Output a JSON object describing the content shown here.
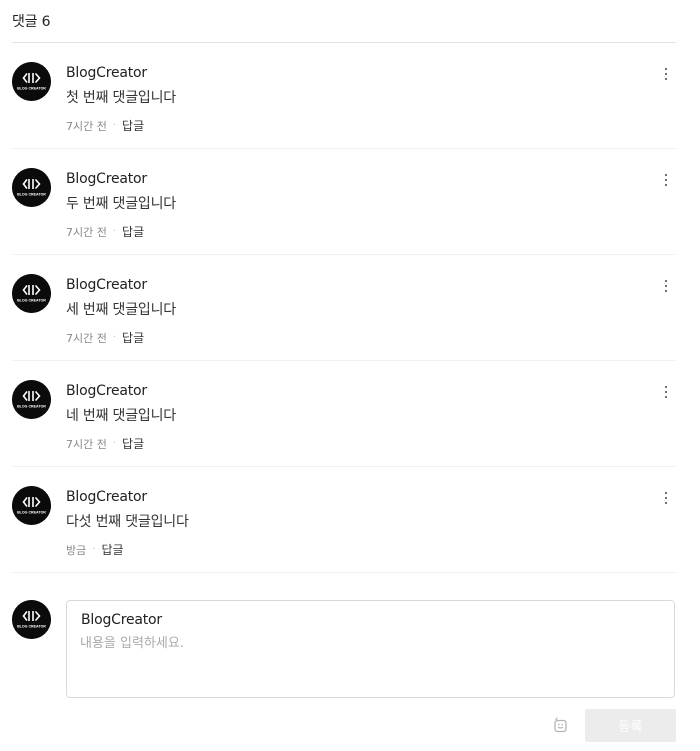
{
  "header": {
    "label": "댓글 6"
  },
  "comments": [
    {
      "author": "BlogCreator",
      "text": "첫 번째 댓글입니다",
      "time": "7시간 전",
      "reply": "답글"
    },
    {
      "author": "BlogCreator",
      "text": "두 번째 댓글입니다",
      "time": "7시간 전",
      "reply": "답글"
    },
    {
      "author": "BlogCreator",
      "text": "세 번째 댓글입니다",
      "time": "7시간 전",
      "reply": "답글"
    },
    {
      "author": "BlogCreator",
      "text": "네 번째 댓글입니다",
      "time": "7시간 전",
      "reply": "답글"
    },
    {
      "author": "BlogCreator",
      "text": "다섯 번째 댓글입니다",
      "time": "방금",
      "reply": "답글"
    }
  ],
  "composer": {
    "author": "BlogCreator",
    "placeholder": "내용을 입력하세요.",
    "value": "",
    "submit_label": "등록",
    "emoji_icon": "emoticon-icon"
  },
  "avatar": {
    "logo_text": "BLOG CREATOR",
    "icon": "blog-creator-logo"
  },
  "colors": {
    "avatar_bg": "#0b0b0b",
    "submit_disabled_bg": "#ececec",
    "divider": "#e2e2e2"
  }
}
